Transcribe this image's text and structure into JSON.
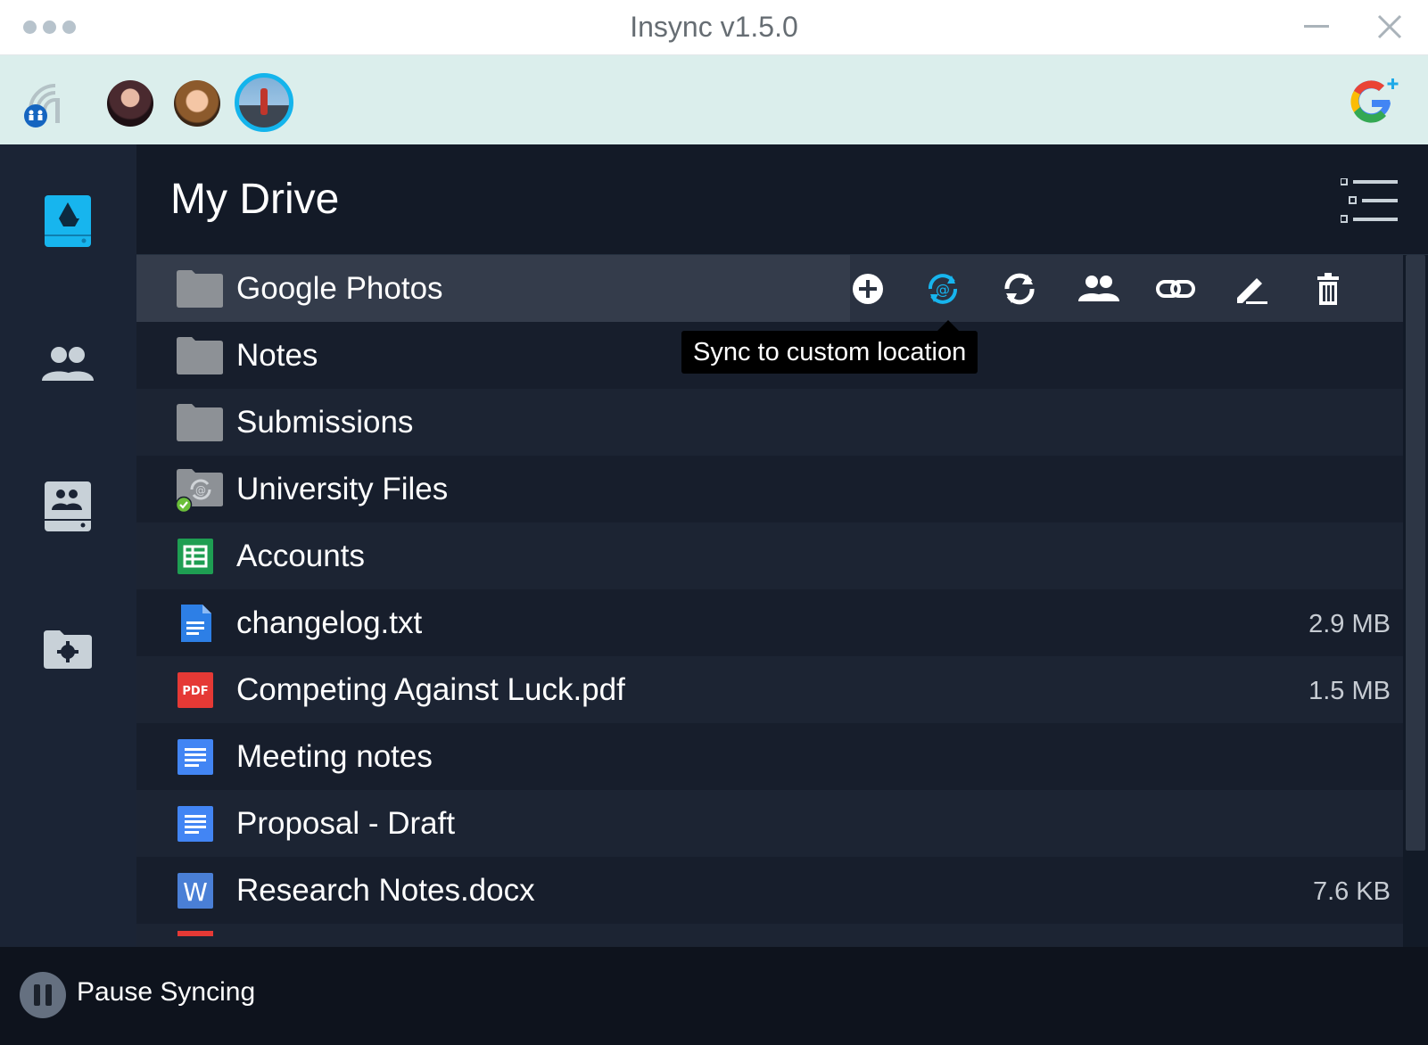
{
  "window": {
    "title": "Insync v1.5.0"
  },
  "accounts": {
    "avatars": [
      "account-avatar-1",
      "account-avatar-2",
      "account-avatar-3-active"
    ],
    "add_account_icon": "google-plus-icon"
  },
  "sidebar": {
    "items": [
      {
        "name": "my-drive",
        "icon": "drive-icon",
        "active": true
      },
      {
        "name": "shared-with-me",
        "icon": "people-icon"
      },
      {
        "name": "team-drives",
        "icon": "team-drive-icon"
      },
      {
        "name": "settings",
        "icon": "folder-settings-icon"
      }
    ]
  },
  "main": {
    "title": "My Drive",
    "rows": [
      {
        "name": "Google Photos",
        "size": "",
        "type": "folder"
      },
      {
        "name": "Notes",
        "size": "",
        "type": "folder"
      },
      {
        "name": "Submissions",
        "size": "",
        "type": "folder"
      },
      {
        "name": "University Files",
        "size": "",
        "type": "synced-folder"
      },
      {
        "name": "Accounts",
        "size": "",
        "type": "sheet"
      },
      {
        "name": "changelog.txt",
        "size": "2.9 MB",
        "type": "text"
      },
      {
        "name": "Competing Against Luck.pdf",
        "size": "1.5 MB",
        "type": "pdf"
      },
      {
        "name": "Meeting notes",
        "size": "",
        "type": "doc"
      },
      {
        "name": "Proposal - Draft",
        "size": "",
        "type": "doc"
      },
      {
        "name": "Research Notes.docx",
        "size": "7.6 KB",
        "type": "word"
      }
    ],
    "row_actions": [
      "add",
      "sync-to-custom-location",
      "sync",
      "share",
      "link",
      "rename",
      "delete"
    ],
    "tooltip": "Sync to custom location"
  },
  "footer": {
    "pause_label": "Pause Syncing"
  },
  "colors": {
    "accent": "#14b4ec",
    "sheet": "#1e9e52",
    "pdf": "#e53935",
    "doc": "#4285f4",
    "success": "#6bbf3a"
  }
}
